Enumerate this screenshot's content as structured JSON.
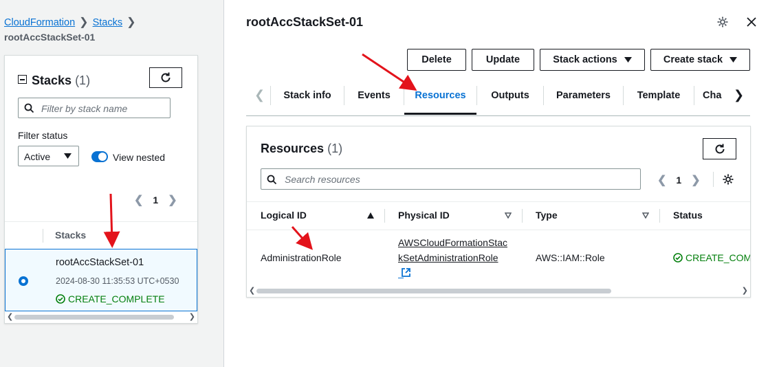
{
  "breadcrumb": {
    "items": [
      "CloudFormation",
      "Stacks"
    ],
    "current": "rootAccStackSet-01"
  },
  "stacks_panel": {
    "title": "Stacks",
    "count": "(1)",
    "filter_placeholder": "Filter by stack name",
    "filter_status_label": "Filter status",
    "filter_status_value": "Active",
    "view_nested_label": "View nested",
    "view_nested_on": true,
    "page": "1",
    "column_header": "Stacks",
    "rows": [
      {
        "name": "rootAccStackSet-01",
        "timestamp": "2024-08-30 11:35:53 UTC+0530",
        "status": "CREATE_COMPLETE",
        "selected": true
      }
    ]
  },
  "detail": {
    "title": "rootAccStackSet-01",
    "buttons": {
      "delete": "Delete",
      "update": "Update",
      "stack_actions": "Stack actions",
      "create_stack": "Create stack"
    },
    "tabs": [
      "Stack info",
      "Events",
      "Resources",
      "Outputs",
      "Parameters",
      "Template",
      "Cha"
    ],
    "active_tab": "Resources"
  },
  "resources": {
    "title": "Resources",
    "count": "(1)",
    "search_placeholder": "Search resources",
    "page": "1",
    "columns": [
      "Logical ID",
      "Physical ID",
      "Type",
      "Status"
    ],
    "rows": [
      {
        "logical_id": "AdministrationRole",
        "physical_id_line1": "AWSCloudFormationStac",
        "physical_id_line2": "kSetAdministrationRole",
        "type": "AWS::IAM::Role",
        "status": "CREATE_COMP"
      }
    ]
  },
  "colors": {
    "link": "#0972d3",
    "success": "#037f0c",
    "annotation": "#e3131b",
    "selected_row_bg": "#f1faff"
  },
  "icons": [
    "refresh-icon",
    "search-icon",
    "settings-icon",
    "close-icon",
    "caret-down-icon",
    "chevron-left-icon",
    "chevron-right-icon",
    "external-link-icon",
    "success-icon",
    "sort-ascending-icon",
    "sort-icon"
  ]
}
